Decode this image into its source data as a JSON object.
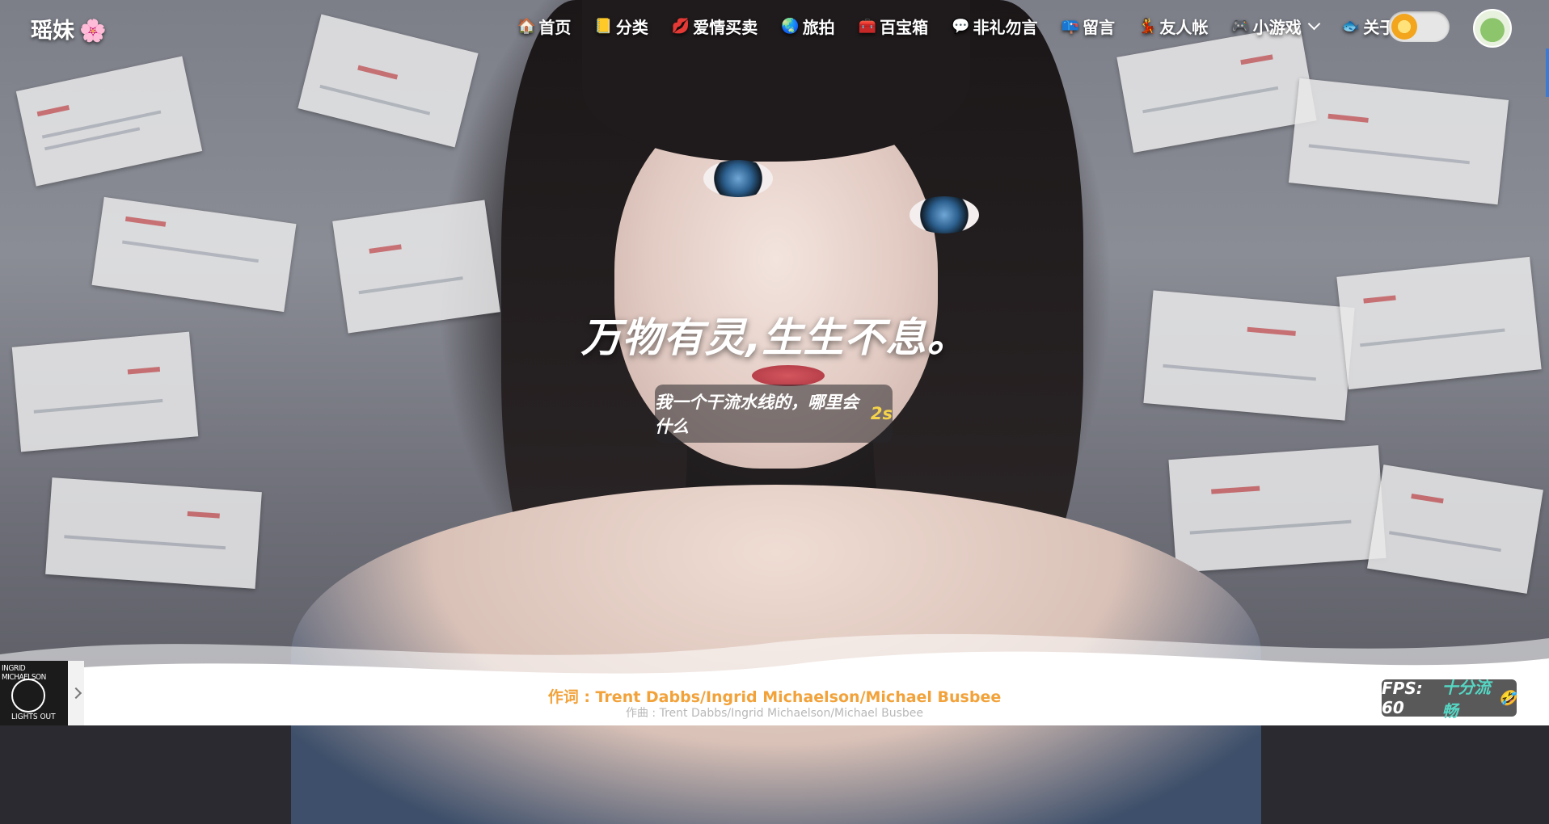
{
  "site": {
    "logo_text": "瑶妹",
    "logo_icon": "🌸"
  },
  "nav": {
    "items": [
      {
        "icon": "🏠",
        "label": "首页"
      },
      {
        "icon": "📒",
        "label": "分类"
      },
      {
        "icon": "💋",
        "label": "爱情买卖"
      },
      {
        "icon": "🌏",
        "label": "旅拍"
      },
      {
        "icon": "🧰",
        "label": "百宝箱"
      },
      {
        "icon": "💬",
        "label": "非礼勿言"
      },
      {
        "icon": "📪",
        "label": "留言"
      },
      {
        "icon": "💃",
        "label": "友人帐"
      },
      {
        "icon": "🎮",
        "label": "小游戏"
      },
      {
        "icon": "🐟",
        "label": "关于"
      }
    ],
    "theme_toggle": "light",
    "avatar_icon": "frog-avatar-icon"
  },
  "hero": {
    "title": "万物有灵,生生不息。",
    "subtitle": "我一个干流水线的，哪里会什么",
    "typing_cursor": "2s"
  },
  "player": {
    "cover_line1": "INGRID MICHAELSON",
    "cover_line2": "LIGHTS OUT",
    "lyric_current": "作词 : Trent Dabbs/Ingrid Michaelson/Michael Busbee",
    "lyric_next": "作曲 : Trent Dabbs/Ingrid Michaelson/Michael Busbee"
  },
  "fps": {
    "label": "FPS: 60",
    "status": "十分流畅",
    "emoji": "🤣"
  },
  "colors": {
    "lyric": "#f2a23a",
    "fps_status": "#55d7c4",
    "cursor": "#f5d34a"
  }
}
